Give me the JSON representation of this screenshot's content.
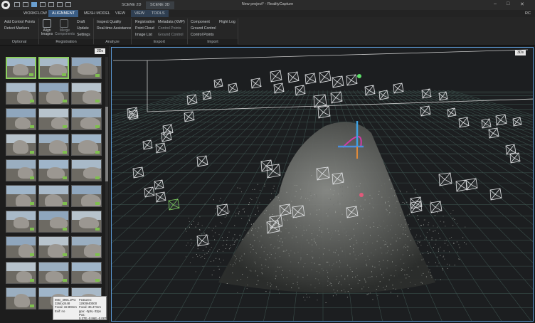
{
  "window": {
    "title": "New project* - RealityCapture",
    "controls": [
      "–",
      "□",
      "✕"
    ],
    "user": "RC"
  },
  "scene_tabs": [
    "SCENE 2D",
    "SCENE 3D"
  ],
  "ribbon_tabs": [
    "WORKFLOW",
    "ALIGNMENT",
    "MESH MODEL",
    "VIEW",
    "VIEW",
    "TOOLS"
  ],
  "ribbon": {
    "optional": {
      "items": [
        "Add Control Points",
        "Detect Markers"
      ],
      "label": "Optional"
    },
    "registration": {
      "align_images": "Align Images",
      "merge_components": "Merge Components",
      "items": [
        "Draft",
        "Update",
        "Settings"
      ],
      "label": "Registration"
    },
    "analyze": {
      "items": [
        "Inspect Quality",
        "Real-time Assistance"
      ],
      "label": "Analyze"
    },
    "export": {
      "items": [
        "Registration",
        "Point Cloud",
        "Image List"
      ],
      "items2": [
        "Metadata (XMP)",
        "Control Points",
        "Ground Control"
      ],
      "label": "Export"
    },
    "import": {
      "items": [
        "Component",
        "Ground Control",
        "Control Points"
      ],
      "flight_log": "Flight Log",
      "label": "Import"
    }
  },
  "left_panel": {
    "badge": "2Ds",
    "tooltip": {
      "left": [
        "IMG_4991.JPG",
        "3264x2448",
        "Focal: 32.80mm",
        "Exif: no"
      ],
      "right": [
        "Features: 12939/40000",
        "Focal: 36.47mm",
        "ppu: -0pts,-32px",
        "Pos: 0.37E,-0.86E,-0.087"
      ]
    }
  },
  "viewport": {
    "badge": "3Ds"
  }
}
